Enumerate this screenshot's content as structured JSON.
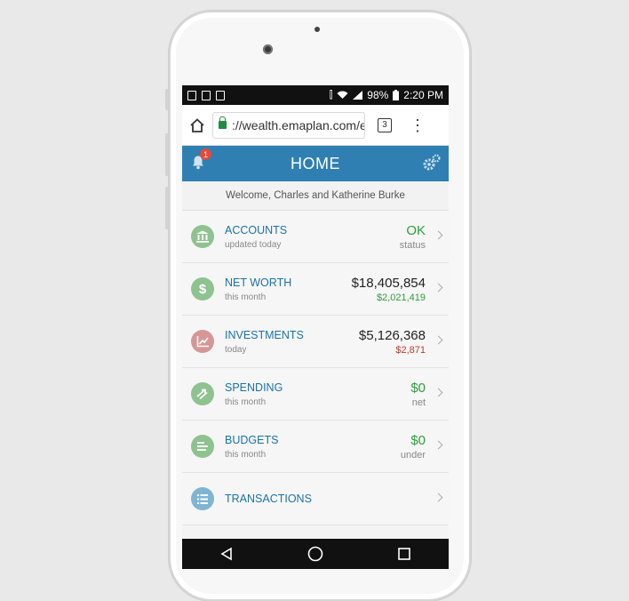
{
  "status_bar": {
    "battery": "98%",
    "time": "2:20 PM"
  },
  "browser": {
    "url": "://wealth.emaplan.com/e",
    "tab_count": "3"
  },
  "app": {
    "title": "HOME",
    "notification_count": "1",
    "welcome": "Welcome, Charles and Katherine Burke"
  },
  "rows": [
    {
      "title": "ACCOUNTS",
      "sub": "updated today",
      "value": "OK",
      "value_sub": "status"
    },
    {
      "title": "NET WORTH",
      "sub": "this month",
      "value": "$18,405,854",
      "value_sub": "$2,021,419"
    },
    {
      "title": "INVESTMENTS",
      "sub": "today",
      "value": "$5,126,368",
      "value_sub": "$2,871"
    },
    {
      "title": "SPENDING",
      "sub": "this month",
      "value": "$0",
      "value_sub": "net"
    },
    {
      "title": "BUDGETS",
      "sub": "this month",
      "value": "$0",
      "value_sub": "under"
    },
    {
      "title": "TRANSACTIONS"
    }
  ],
  "icons": {
    "accounts": "bank-icon",
    "net_worth": "dollar-icon",
    "investments": "chart-up-icon",
    "spending": "exchange-icon",
    "budgets": "budget-list-icon",
    "transactions": "list-icon"
  },
  "colors": {
    "app_bar": "#2f7fb3",
    "link_blue": "#1a73a8",
    "positive": "#2e9e3a",
    "negative": "#c0392b",
    "badge": "#e24a3b"
  }
}
